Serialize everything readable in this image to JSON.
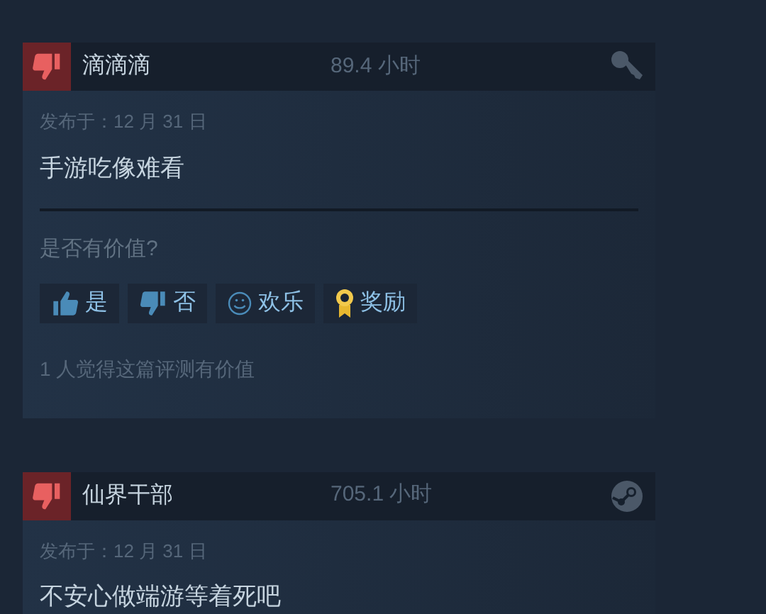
{
  "reviews": [
    {
      "recommended": false,
      "author": "滴滴滴",
      "hours": "89.4 小时",
      "kind": "key",
      "date": "发布于：12 月 31 日",
      "text": "手游吃像难看",
      "helpful_prompt": "是否有价值?",
      "actions": [
        {
          "kind": "up",
          "label": "是"
        },
        {
          "kind": "down",
          "label": "否"
        },
        {
          "kind": "funny",
          "label": "欢乐"
        },
        {
          "kind": "award",
          "label": "奖励"
        }
      ],
      "helpful_count": "1 人觉得这篇评测有价值"
    },
    {
      "recommended": false,
      "author": "仙界干部",
      "hours": "705.1 小时",
      "kind": "steam",
      "date": "发布于：12 月 31 日",
      "text": "不安心做端游等着死吧"
    }
  ]
}
